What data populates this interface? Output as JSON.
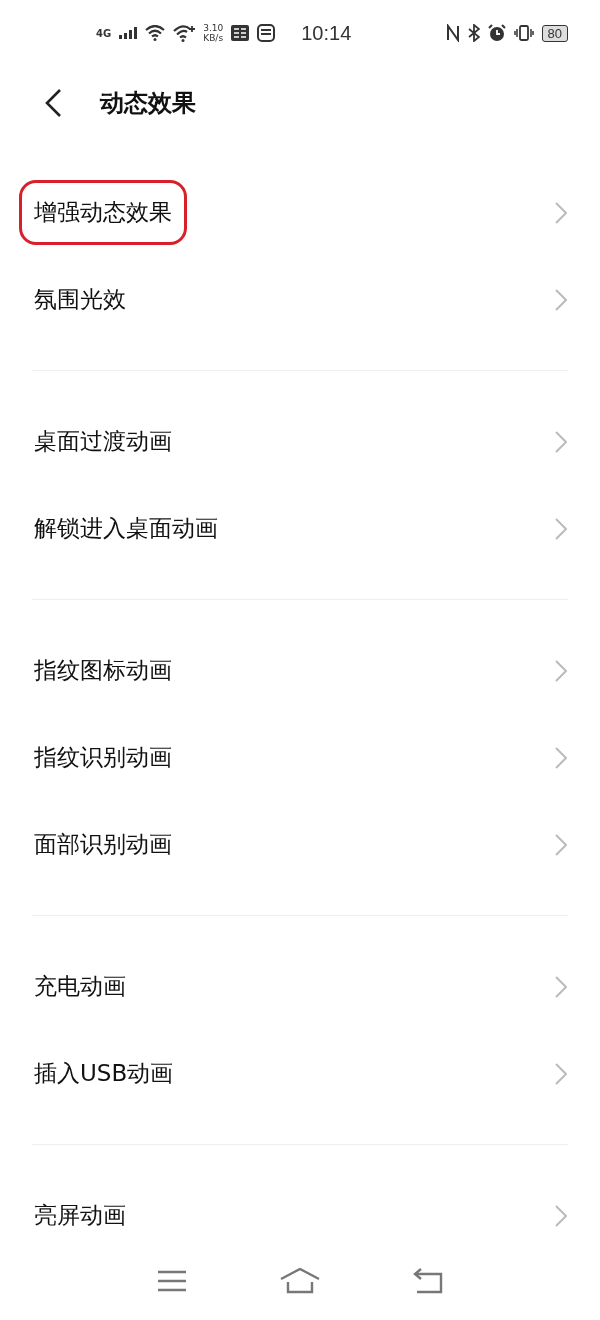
{
  "status_bar": {
    "network": "4G",
    "speed": "3.10",
    "speed_unit": "KB/s",
    "time": "10:14",
    "battery": "80"
  },
  "header": {
    "title": "动态效果"
  },
  "groups": [
    {
      "items": [
        {
          "label": "增强动态效果",
          "highlighted": true
        },
        {
          "label": "氛围光效",
          "highlighted": false
        }
      ]
    },
    {
      "items": [
        {
          "label": "桌面过渡动画",
          "highlighted": false
        },
        {
          "label": "解锁进入桌面动画",
          "highlighted": false
        }
      ]
    },
    {
      "items": [
        {
          "label": "指纹图标动画",
          "highlighted": false
        },
        {
          "label": "指纹识别动画",
          "highlighted": false
        },
        {
          "label": "面部识别动画",
          "highlighted": false
        }
      ]
    },
    {
      "items": [
        {
          "label": "充电动画",
          "highlighted": false
        },
        {
          "label": "插入USB动画",
          "highlighted": false
        }
      ]
    },
    {
      "items": [
        {
          "label": "亮屏动画",
          "highlighted": false
        }
      ]
    }
  ]
}
